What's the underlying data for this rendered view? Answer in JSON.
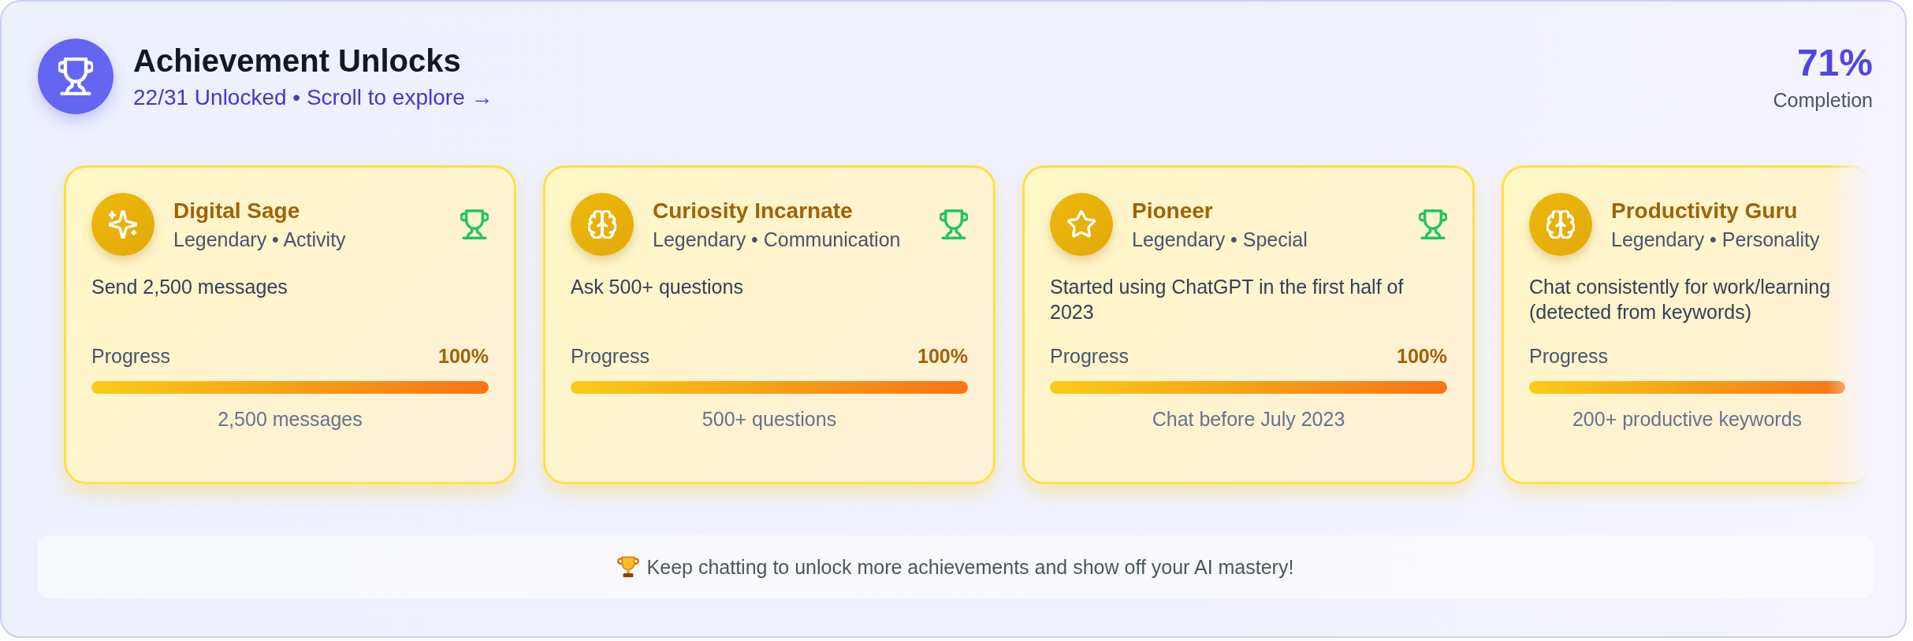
{
  "header": {
    "title": "Achievement Unlocks",
    "summary": "22/31 Unlocked • Scroll to explore →",
    "completion": "71%",
    "completion_label": "Completion"
  },
  "cards": [
    {
      "kind": "sparkles",
      "title": "Digital Sage",
      "meta": "Legendary • Activity",
      "unlocked": true,
      "description": "Send 2,500 messages",
      "progress_label": "Progress",
      "percent": "100%",
      "level": 1,
      "goal": "2,500 messages"
    },
    {
      "kind": "brain",
      "title": "Curiosity Incarnate",
      "meta": "Legendary • Communication",
      "unlocked": true,
      "description": "Ask 500+ questions",
      "progress_label": "Progress",
      "percent": "100%",
      "level": 1,
      "goal": "500+ questions"
    },
    {
      "kind": "star",
      "title": "Pioneer",
      "meta": "Legendary • Special",
      "unlocked": true,
      "description": "Started using ChatGPT in the first half of 2023",
      "progress_label": "Progress",
      "percent": "100%",
      "level": 1,
      "goal": "Chat before July 2023"
    },
    {
      "kind": "brain",
      "title": "Productivity Guru",
      "meta": "Legendary • Personality",
      "description": "Chat consistently for work/learning (detected from keywords)",
      "progress_label": "Progress",
      "level": 1,
      "goal": "200+ productive keywords"
    }
  ],
  "footer": {
    "message": "Keep chatting to unlock more achievements and show off your AI mastery!"
  }
}
